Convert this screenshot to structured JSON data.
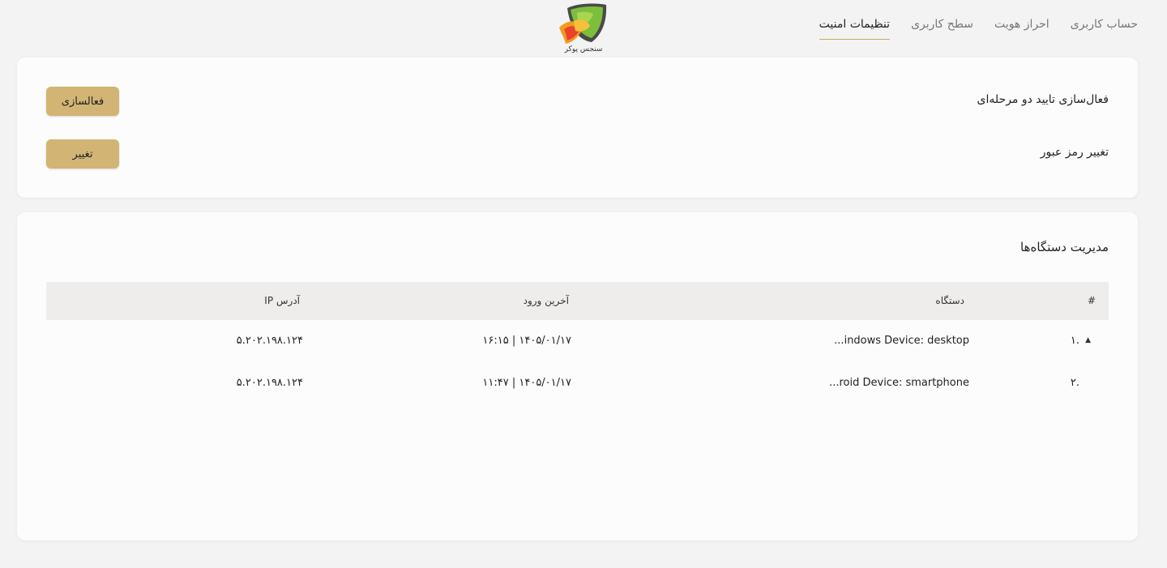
{
  "nav": {
    "tabs": [
      {
        "label": "حساب کاربری",
        "active": false
      },
      {
        "label": "احراز هویت",
        "active": false
      },
      {
        "label": "سطح کاربری",
        "active": false
      },
      {
        "label": "تنظیمات امنیت",
        "active": true
      }
    ],
    "logo_caption": "سنجس پوکر"
  },
  "security": {
    "two_factor_label": "فعال‌سازی تایید دو مرحله‌ای",
    "two_factor_button": "فعالسازی",
    "password_label": "تغییر رمز عبور",
    "password_button": "تغییر"
  },
  "devices": {
    "title": "مدیریت دستگاه‌ها",
    "columns": {
      "num": "#",
      "device": "دستگاه",
      "last_login": "آخرین ورود",
      "ip": "آدرس IP"
    },
    "rows": [
      {
        "num": ".۱",
        "device": "indows Device: desktop...",
        "last_login": "۱۴۰۵/۰۱/۱۷ | ۱۶:۱۵",
        "ip": "۵.۲۰۲.۱۹۸.۱۲۴",
        "expanded": true
      },
      {
        "num": ".۲",
        "device": "roid Device: smartphone...",
        "last_login": "۱۴۰۵/۰۱/۱۷ | ۱۱:۴۷",
        "ip": "۵.۲۰۲.۱۹۸.۱۲۴",
        "expanded": false
      }
    ]
  },
  "colors": {
    "accent": "#d2b474",
    "tab_underline": "#c8a860",
    "page_bg": "#f3f3f3",
    "card_bg": "#fcfcfc",
    "table_header_bg": "#eeedeb"
  },
  "icons": {
    "logo": "wolf-shield-logo",
    "row_caret": "caret-up-icon"
  }
}
